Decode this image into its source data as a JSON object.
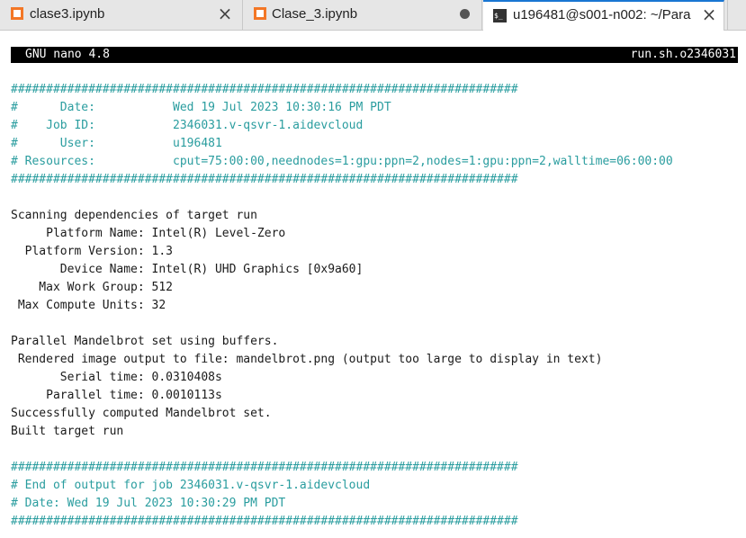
{
  "tabs": [
    {
      "label": "clase3.ipynb",
      "icon": "notebook-icon",
      "state": "close"
    },
    {
      "label": "Clase_3.ipynb",
      "icon": "notebook-icon",
      "state": "unsaved"
    },
    {
      "label": "u196481@s001-n002: ~/Para",
      "icon": "terminal-icon",
      "state": "active"
    }
  ],
  "nano": {
    "title": "GNU nano 4.8",
    "filename": "run.sh.o2346031"
  },
  "colors": {
    "accent": "#1976d2",
    "notebook_icon": "#f37726",
    "comment_text": "#2a9d9f"
  },
  "output_lines": [
    {
      "text": "########################################################################",
      "style": "cyan"
    },
    {
      "text": "#      Date:           Wed 19 Jul 2023 10:30:16 PM PDT",
      "style": "cyan"
    },
    {
      "text": "#    Job ID:           2346031.v-qsvr-1.aidevcloud",
      "style": "cyan"
    },
    {
      "text": "#      User:           u196481",
      "style": "cyan"
    },
    {
      "text": "# Resources:           cput=75:00:00,neednodes=1:gpu:ppn=2,nodes=1:gpu:ppn=2,walltime=06:00:00",
      "style": "cyan"
    },
    {
      "text": "########################################################################",
      "style": "cyan"
    },
    {
      "text": "",
      "style": "plain"
    },
    {
      "text": "Scanning dependencies of target run",
      "style": "plain"
    },
    {
      "text": "     Platform Name: Intel(R) Level-Zero",
      "style": "plain"
    },
    {
      "text": "  Platform Version: 1.3",
      "style": "plain"
    },
    {
      "text": "       Device Name: Intel(R) UHD Graphics [0x9a60]",
      "style": "plain"
    },
    {
      "text": "    Max Work Group: 512",
      "style": "plain"
    },
    {
      "text": " Max Compute Units: 32",
      "style": "plain"
    },
    {
      "text": "",
      "style": "plain"
    },
    {
      "text": "Parallel Mandelbrot set using buffers.",
      "style": "plain"
    },
    {
      "text": " Rendered image output to file: mandelbrot.png (output too large to display in text)",
      "style": "plain"
    },
    {
      "text": "       Serial time: 0.0310408s",
      "style": "plain"
    },
    {
      "text": "     Parallel time: 0.0010113s",
      "style": "plain"
    },
    {
      "text": "Successfully computed Mandelbrot set.",
      "style": "plain"
    },
    {
      "text": "Built target run",
      "style": "plain"
    },
    {
      "text": "",
      "style": "plain"
    },
    {
      "text": "########################################################################",
      "style": "cyan"
    },
    {
      "text": "# End of output for job 2346031.v-qsvr-1.aidevcloud",
      "style": "cyan"
    },
    {
      "text": "# Date: Wed 19 Jul 2023 10:30:29 PM PDT",
      "style": "cyan"
    },
    {
      "text": "########################################################################",
      "style": "cyan"
    }
  ]
}
